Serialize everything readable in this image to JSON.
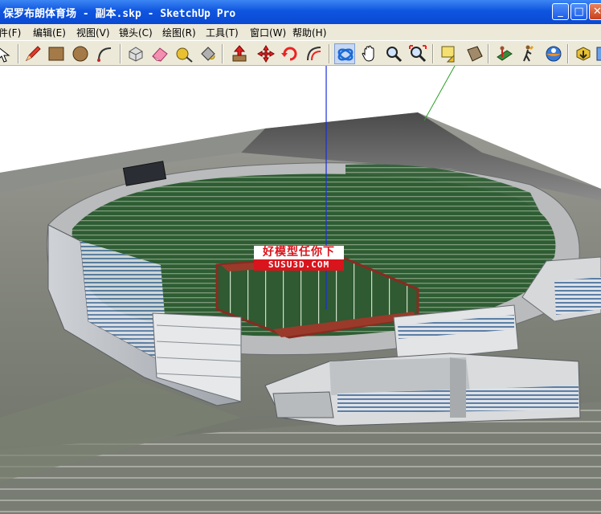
{
  "window": {
    "title": "保罗布朗体育场 - 副本.skp - SketchUp Pro"
  },
  "menu": [
    {
      "label": "件(F)"
    },
    {
      "label": "编辑(E)"
    },
    {
      "label": "视图(V)"
    },
    {
      "label": "镜头(C)"
    },
    {
      "label": "绘图(R)"
    },
    {
      "label": "工具(T)"
    },
    {
      "label": "窗口(W)"
    },
    {
      "label": "帮助(H)"
    }
  ],
  "toolbar": {
    "tools": [
      {
        "icon": "select-arrow-icon"
      },
      {
        "icon": "pencil-icon"
      },
      {
        "icon": "rectangle-icon"
      },
      {
        "icon": "circle-icon"
      },
      {
        "icon": "arc-icon"
      },
      {
        "icon": "make-component-icon"
      },
      {
        "icon": "eraser-icon"
      },
      {
        "icon": "tape-measure-icon"
      },
      {
        "icon": "paint-bucket-icon"
      },
      {
        "icon": "push-pull-icon"
      },
      {
        "icon": "move-icon"
      },
      {
        "icon": "rotate-icon"
      },
      {
        "icon": "offset-icon"
      },
      {
        "icon": "orbit-icon"
      },
      {
        "icon": "pan-hand-icon"
      },
      {
        "icon": "zoom-icon"
      },
      {
        "icon": "zoom-extents-icon"
      },
      {
        "icon": "previous-view-icon"
      },
      {
        "icon": "next-view-icon"
      },
      {
        "icon": "position-camera-icon"
      },
      {
        "icon": "walk-icon"
      },
      {
        "icon": "look-around-icon"
      },
      {
        "icon": "get-models-icon"
      }
    ],
    "active_tool": "orbit-icon"
  },
  "viewport": {
    "watermark_line1": "好模型任你下",
    "watermark_line2": "SUSU3D.COM",
    "colors": {
      "axis_blue": "#1a2fd8",
      "axis_green": "#2aa02a",
      "watermark_red": "#d9141c"
    }
  }
}
